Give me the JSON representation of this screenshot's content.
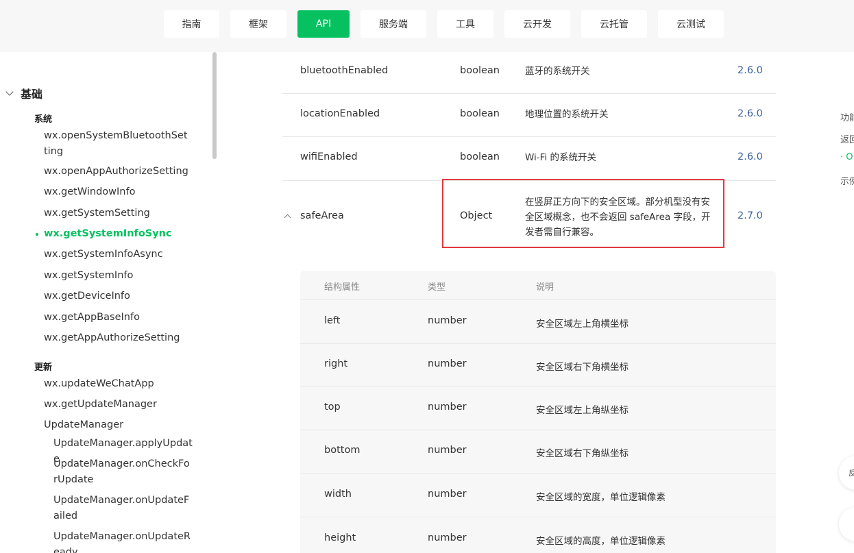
{
  "nav": {
    "tabs": [
      {
        "label": "指南"
      },
      {
        "label": "框架"
      },
      {
        "label": "API"
      },
      {
        "label": "服务端"
      },
      {
        "label": "工具"
      },
      {
        "label": "云开发"
      },
      {
        "label": "云托管"
      },
      {
        "label": "云测试"
      }
    ],
    "active": "API"
  },
  "sidebar": {
    "section_title": "基础",
    "group_system": "系统",
    "system_items": [
      "wx.openSystemBluetoothSetting",
      "wx.openAppAuthorizeSetting",
      "wx.getWindowInfo",
      "wx.getSystemSetting",
      "wx.getSystemInfoSync",
      "wx.getSystemInfoAsync",
      "wx.getSystemInfo",
      "wx.getDeviceInfo",
      "wx.getAppBaseInfo",
      "wx.getAppAuthorizeSetting"
    ],
    "group_update": "更新",
    "update_items": [
      "wx.updateWeChatApp",
      "wx.getUpdateManager",
      "UpdateManager"
    ],
    "update_manager_items": [
      "UpdateManager.applyUpdate",
      "UpdateManager.onCheckForUpdate",
      "UpdateManager.onUpdateFailed",
      "UpdateManager.onUpdateReady"
    ]
  },
  "table": {
    "rows": [
      {
        "name": "bluetoothEnabled",
        "type": "boolean",
        "desc": "蓝牙的系统开关",
        "version": "2.6.0"
      },
      {
        "name": "locationEnabled",
        "type": "boolean",
        "desc": "地理位置的系统开关",
        "version": "2.6.0"
      },
      {
        "name": "wifiEnabled",
        "type": "boolean",
        "desc": "Wi-Fi 的系统开关",
        "version": "2.6.0"
      },
      {
        "name": "safeArea",
        "type": "Object",
        "desc": "在竖屏正方向下的安全区域。部分机型没有安全区域概念，也不会返回 safeArea 字段，开发者需自行兼容。",
        "version": "2.7.0"
      }
    ]
  },
  "nested": {
    "headers": {
      "prop": "结构属性",
      "type": "类型",
      "desc": "说明"
    },
    "rows": [
      {
        "name": "left",
        "type": "number",
        "desc": "安全区域左上角横坐标"
      },
      {
        "name": "right",
        "type": "number",
        "desc": "安全区域右下角横坐标"
      },
      {
        "name": "top",
        "type": "number",
        "desc": "安全区域左上角纵坐标"
      },
      {
        "name": "bottom",
        "type": "number",
        "desc": "安全区域右下角纵坐标"
      },
      {
        "name": "width",
        "type": "number",
        "desc": "安全区域的宽度，单位逻辑像素"
      },
      {
        "name": "height",
        "type": "number",
        "desc": "安全区域的高度，单位逻辑像素"
      }
    ]
  },
  "right_panel": {
    "line1": "功能",
    "line2": "返回",
    "line3": "· O",
    "line4": "示例",
    "float1": "反"
  },
  "colors": {
    "accent": "#07c160",
    "highlight": "#e0393e",
    "version_link": "#3a5f9e"
  }
}
